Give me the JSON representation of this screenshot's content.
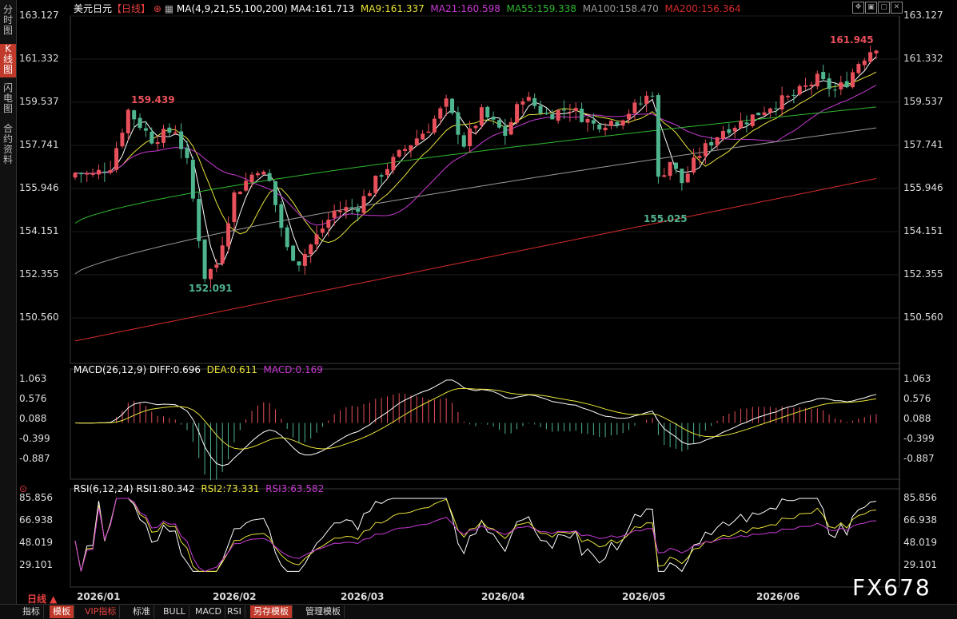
{
  "sidebar": {
    "tabs": [
      {
        "label": "分\n时\n图",
        "active": false
      },
      {
        "label": "K\n线\n图",
        "active": true
      },
      {
        "label": "闪\n电\n图",
        "active": false
      },
      {
        "label": "合\n约\n资\n料",
        "active": false
      }
    ]
  },
  "header": {
    "symbol": "美元日元",
    "period": "【日线】",
    "ma_params": "MA(4,9,21,55,100,200)",
    "ma4": "MA4:161.713",
    "ma9": "MA9:161.337",
    "ma21": "MA21:160.598",
    "ma55": "MA55:159.338",
    "ma100": "MA100:158.470",
    "ma200": "MA200:156.364"
  },
  "macd_header": {
    "title": "MACD(26,12,9)",
    "diff": "DIFF:0.696",
    "dea": "DEA:0.611",
    "macd": "MACD:0.169"
  },
  "rsi_header": {
    "title": "RSI(6,12,24)",
    "rsi1": "RSI1:80.342",
    "rsi2": "RSI2:73.331",
    "rsi3": "RSI3:63.582"
  },
  "price_axis": [
    "163.127",
    "161.332",
    "159.537",
    "157.741",
    "155.946",
    "154.151",
    "152.355",
    "150.560"
  ],
  "macd_axis": [
    "1.063",
    "0.576",
    "0.088",
    "-0.399",
    "-0.887"
  ],
  "rsi_axis": [
    "85.856",
    "66.938",
    "48.019",
    "29.101"
  ],
  "x_axis": [
    "2026/01",
    "2026/02",
    "2026/03",
    "2026/04",
    "2026/05",
    "2026/06"
  ],
  "annotations": {
    "high1": "159.439",
    "low1": "152.091",
    "low2": "155.025",
    "high2": "161.945"
  },
  "period_selector": "日线 ▲",
  "bottom_tabs": [
    {
      "label": "指标",
      "style": "normal"
    },
    {
      "label": "模板",
      "style": "hl"
    },
    {
      "label": "VIP指标",
      "style": "vip"
    },
    {
      "label": "标准",
      "style": "normal"
    },
    {
      "label": "BULL",
      "style": "normal"
    },
    {
      "label": "MACD",
      "style": "normal"
    },
    {
      "label": "RSI",
      "style": "normal"
    },
    {
      "label": "另存模板",
      "style": "hl"
    },
    {
      "label": "管理模板",
      "style": "normal"
    }
  ],
  "watermark": "FX678",
  "colors": {
    "up": "#e8505b",
    "down": "#4fb58f",
    "ma4": "#ffffff",
    "ma9": "#e8e33a",
    "ma21": "#c93ad6",
    "ma55": "#2fb82f",
    "ma100": "#9a9a9a",
    "ma200": "#d62b2b"
  }
}
